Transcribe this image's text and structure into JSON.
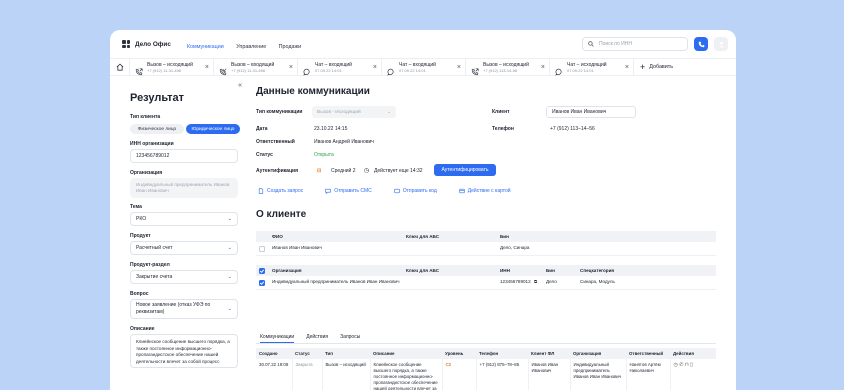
{
  "app": {
    "title": "Дело Офис"
  },
  "nav": [
    "Коммуникации",
    "Управление",
    "Продажи"
  ],
  "search": {
    "placeholder": "Поиск по ИНН"
  },
  "tabs": [
    {
      "title": "Вызов – исходящий",
      "sub": "+7 (912) 11-31-456",
      "icon": "phone-outgoing-icon"
    },
    {
      "title": "Вызов – входящий",
      "sub": "+7 (912) 11-31-456",
      "icon": "phone-incoming-icon"
    },
    {
      "title": "Чат – входящий",
      "sub": "07.09.22 14:01",
      "icon": "chat-icon"
    },
    {
      "title": "Чат – входящий",
      "sub": "07.09.22 14:01",
      "icon": "chat-icon"
    },
    {
      "title": "Вызов – исходящий",
      "sub": "+7 (912) 113-14-56",
      "icon": "phone-outgoing-icon"
    },
    {
      "title": "Чат – исходящий",
      "sub": "07.09.22 14:01",
      "icon": "chat-icon"
    }
  ],
  "add_tab": "Добавить",
  "sidebar": {
    "title": "Результат",
    "client_type_label": "Тип клиента",
    "client_types": [
      "Физическое лицо",
      "Юридическое лицо"
    ],
    "inn_label": "ИНН организации",
    "inn_value": "123456789012",
    "org_label": "Организация",
    "org_value": "Индивидуальный предприниматель Иванов Иван Иванович",
    "topic_label": "Тема",
    "topic_value": "РКО",
    "product_label": "Продукт",
    "product_value": "Расчетный счет",
    "subproduct_label": "Продукт-раздел",
    "subproduct_value": "Закрытие счета",
    "question_label": "Вопрос",
    "question_value": "Новое заявление (отказ УФЭ по реквизитам)",
    "desc_label": "Описание",
    "desc_value": "Клиейнское сообщение высшего порядка, а также постоянное информационно-пропагандистское обеспечение нашей деятельности влечет за собой процесс"
  },
  "main": {
    "title": "Данные коммуникации",
    "comm_type_label": "Тип коммуникации",
    "comm_type_value": "Вызов - Исходящий",
    "date_label": "Дата",
    "date_value": "23.10.22 14:15",
    "resp_label": "Ответственный",
    "resp_value": "Иванов Андрей Иванович",
    "status_label": "Статус",
    "status_value": "Открыта",
    "client_label": "Клиент",
    "client_value": "Иванов Иван Иванович",
    "phone_label": "Телефон",
    "phone_value": "+7 (912) 113–14–56",
    "auth_label": "Аутентификация",
    "auth_level": "Средний 2",
    "auth_valid": "Действует еще 14:32",
    "auth_button": "Аутентифицировать",
    "actions": [
      "Создать запрос",
      "Отправить СМС",
      "Отправить код",
      "Действие с картой"
    ],
    "about_title": "О клиенте",
    "person_headers": [
      "ФИО",
      "Ключ для АБС",
      "Бин"
    ],
    "person_row": [
      "Иванов Иван Иванович",
      "",
      "Дело, Синара"
    ],
    "org_headers": [
      "Организация",
      "Ключ для АБС",
      "ИНН",
      "Бин",
      "Спецкатегория"
    ],
    "org_row": [
      "Индивидуальный предприниматель Иванов Иван Иванович",
      "",
      "123456789012",
      "Дело",
      "Синара, Модуль"
    ],
    "subtabs": [
      "Коммуникации",
      "Действия",
      "Запросы"
    ],
    "comm_headers": [
      "Создано",
      "Статус",
      "Тип",
      "Описание",
      "Уровень",
      "Телефон",
      "Клиент ФЛ",
      "Организация",
      "Ответственный",
      "Действия"
    ],
    "comm_row": {
      "created": "30.07.22 19:09",
      "status": "Закрыта",
      "type": "Вызов – исходящий",
      "desc": "Клиейнское сообщение высшего порядка, а также постоянное информационно-пропагандистское обеспечение нашей деятельности влечет за собой процесс",
      "level": "С2",
      "phone": "+7 (912) 875–78–85",
      "client": "Иванов Иван Иванович",
      "org": "Индивидуальный предприниматель Иванов Иван Иванович",
      "resp": "Нанятов Артём Николаевич"
    }
  },
  "colors": {
    "accent": "#2d6cf0",
    "background": "#bcd3f8",
    "ok": "#2ba24c",
    "warn": "#e07b2a"
  }
}
